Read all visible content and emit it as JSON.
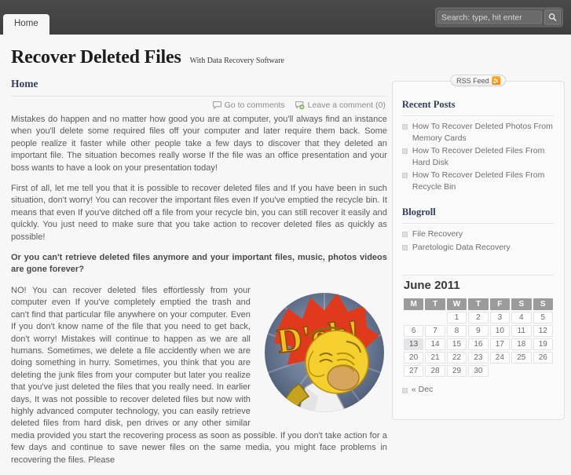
{
  "nav": {
    "tabs": [
      {
        "label": "Home"
      }
    ],
    "search": {
      "placeholder": "Search: type, hit enter",
      "value": "",
      "icon": "search-icon"
    }
  },
  "masthead": {
    "title": "Recover Deleted Files",
    "tagline": "With Data Recovery Software"
  },
  "post": {
    "title": "Home",
    "meta": {
      "go_to_comments": "Go to comments",
      "leave_comment": "Leave a comment (0)"
    },
    "paragraphs": [
      "Mistakes do happen and no matter how good you are at computer, you'll always find an instance when you'll delete some required files off your computer and later require them back. Some people realize it faster while other people take a few days to discover that they deleted an important file. The situation becomes really worse If the file was an office presentation and your boss wants to have a look on your presentation today!",
      "First of all, let me tell you that it is possible to recover deleted files and If you have been in such situation, don't worry! You can recover the important files even If you've emptied the recycle bin. It means that even If you've ditched off a file from your recycle bin, you can still recover it easily and quickly. You just need to make sure that you take action to recover deleted files as quickly as possible!"
    ],
    "bold_question": "Or you can't retrieve deleted files anymore and your important files, music, photos videos are gone forever?",
    "body": "NO! You can recover deleted files effortlessly from your computer even If you've completely emptied the trash and can't find that particular file anywhere on your computer. Even If you don't know name of the file that you need to get back, don't worry! Mistakes will continue to happen as we are all humans. Sometimes, we delete a file accidently when we are doing something in hurry. Sometimes, you think that you are deleting the junk files from your computer but later you realize that you've just deleted the files that you really need. In earlier days, It was not possible to recover deleted files but now with highly advanced computer technology, you can easily retrieve deleted files from hard disk, pen drives or any other similar media provided you start the recovering process as soon as possible. If you don't take action for a few days and continue to save newer files on the same media, you might face problems in recovering the files. Please",
    "image_alt": "D'oh! Homer Simpson balloon",
    "image_text": "D'oh!"
  },
  "sidebar": {
    "rss": {
      "label": "RSS Feed",
      "icon": "rss-icon"
    },
    "recent_posts": {
      "heading": "Recent Posts",
      "items": [
        {
          "label": "How To Recover Deleted Photos From Memory Cards"
        },
        {
          "label": "How To Recover Deleted Files From Hard Disk"
        },
        {
          "label": "How To Recover Deleted Files From Recycle Bin"
        }
      ]
    },
    "blogroll": {
      "heading": "Blogroll",
      "items": [
        {
          "label": "File Recovery"
        },
        {
          "label": "Paretologic Data Recovery"
        }
      ]
    },
    "calendar": {
      "title": "June 2011",
      "weekdays": [
        "M",
        "T",
        "W",
        "T",
        "F",
        "S",
        "S"
      ],
      "lead_blanks": 2,
      "days": [
        1,
        2,
        3,
        4,
        5,
        6,
        7,
        8,
        9,
        10,
        11,
        12,
        13,
        14,
        15,
        16,
        17,
        18,
        19,
        20,
        21,
        22,
        23,
        24,
        25,
        26,
        27,
        28,
        29,
        30
      ],
      "highlighted_day": 13,
      "prev_label": "« Dec"
    }
  },
  "colors": {
    "navbar": "#454545",
    "heading": "#31405c",
    "text": "#5a5a5a",
    "rss_orange": "#f08a00",
    "weekday_header": "#9b9b9b"
  }
}
